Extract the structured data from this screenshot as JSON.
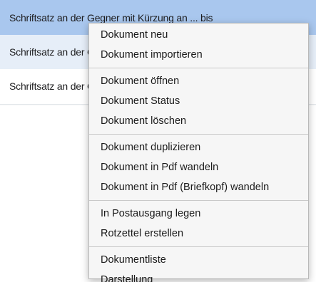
{
  "document_list": {
    "rows": [
      {
        "title": "Schriftsatz an der Gegner mit Kürzung an ... bis",
        "state": "selected"
      },
      {
        "title": "Schriftsatz an der Gegner",
        "state": "alt"
      },
      {
        "title": "Schriftsatz an der Gegner",
        "state": "plain"
      }
    ]
  },
  "context_menu": {
    "groups": [
      [
        "Dokument neu",
        "Dokument importieren"
      ],
      [
        "Dokument öffnen",
        "Dokument Status",
        "Dokument löschen"
      ],
      [
        "Dokument duplizieren",
        "Dokument in Pdf wandeln",
        "Dokument in Pdf (Briefkopf) wandeln"
      ],
      [
        "In Postausgang legen",
        "Rotzettel erstellen"
      ],
      [
        "Dokumentliste",
        "Darstellung"
      ]
    ]
  },
  "colors": {
    "selected_row": "#a9c7ee",
    "alt_row": "#e6eef8",
    "menu_bg": "#f6f6f6",
    "separator": "#c9c9c9"
  }
}
